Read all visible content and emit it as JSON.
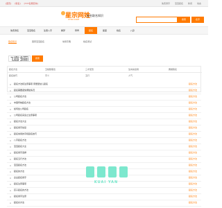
{
  "topbar": {
    "left_links": [
      "[首页]",
      "[取名]",
      "[TXT名典查询]"
    ],
    "right_links": [
      "免费测字",
      "宝宝起名",
      "新闻",
      "动态"
    ]
  },
  "header": {
    "logo_text": "星宗网姓",
    "logo_sub": "XYOX.COM",
    "slogan": "起名取名知识",
    "search_placeholder": "",
    "search_button": "搜索",
    "search_button_2": "名字"
  },
  "nav": {
    "items": [
      {
        "label": "免费测名"
      },
      {
        "label": "宝宝取名"
      },
      {
        "label": "生辰八字"
      },
      {
        "label": "解梦"
      },
      {
        "label": "称骨"
      },
      {
        "label": "起名"
      },
      {
        "label": "星座"
      },
      {
        "label": "姓名"
      },
      {
        "label": "八卦"
      }
    ],
    "active_index": 5
  },
  "subtabs": {
    "items": [
      "取名知识",
      "国家宝宝起名",
      "常用字典",
      "姓名测试"
    ],
    "active_index": 0
  },
  "filter": {
    "placeholder": "请输入姓名",
    "button": "搜索"
  },
  "table": {
    "headers": [
      "起名方法",
      "五格数理法",
      "三才配置",
      "生肖喜忌用",
      "属相取名"
    ],
    "row2": [
      "起名技巧",
      "字义",
      "五行",
      "人气"
    ]
  },
  "list": {
    "rows": [
      {
        "title": "起名方法和注意事项·家居婴幼儿起名",
        "tag": "起名方法"
      },
      {
        "title": "起名需要避免哪些情况",
        "tag": "起名方法"
      },
      {
        "title": "公司起名方法",
        "tag": "起名方法"
      },
      {
        "title": "中国传统起名方法",
        "tag": "起名方法"
      },
      {
        "title": "如何给公司起名",
        "tag": "起名方法"
      },
      {
        "title": "公司起名来运之注意事项",
        "tag": "起名方法"
      },
      {
        "title": "起名方法大全",
        "tag": "起名方法"
      },
      {
        "title": "起名用字禁忌",
        "tag": "起名方法"
      },
      {
        "title": "起名常用的字和起名技巧",
        "tag": "起名方法"
      },
      {
        "title": "八字起名方法",
        "tag": "起名方法"
      },
      {
        "title": "宝宝起名大全",
        "tag": "起名方法"
      },
      {
        "title": "起名用字选择",
        "tag": "起名方法"
      },
      {
        "title": "起名五行方法",
        "tag": "起名方法"
      },
      {
        "title": "宝宝起名方法",
        "tag": "起名方法"
      },
      {
        "title": "起名的方法",
        "tag": "起名方法"
      },
      {
        "title": "企业起名用字",
        "tag": "起名方法"
      },
      {
        "title": "起名注意事项",
        "tag": "起名方法"
      },
      {
        "title": "孩子起名的方法",
        "tag": "起名方法"
      },
      {
        "title": "起名用字注意",
        "tag": "起名方法"
      },
      {
        "title": "起名好方法",
        "tag": "起名方法"
      }
    ]
  },
  "watermark": {
    "text": "KUAI YAN"
  },
  "colors": {
    "accent": "#ff7a00",
    "watermark": "#6fe6c9"
  }
}
